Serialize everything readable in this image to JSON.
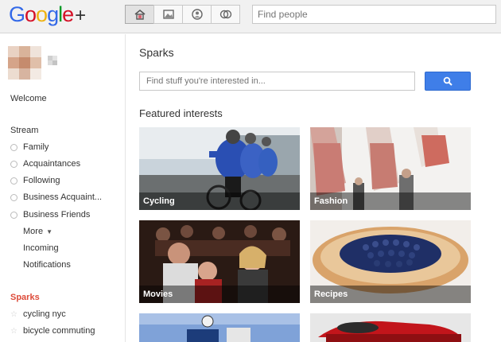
{
  "header": {
    "logo_letters": [
      "G",
      "o",
      "o",
      "g",
      "l",
      "e"
    ],
    "logo_plus": "+",
    "nav": [
      {
        "name": "home-icon",
        "active": true
      },
      {
        "name": "photos-icon",
        "active": false
      },
      {
        "name": "profile-icon",
        "active": false
      },
      {
        "name": "circles-icon",
        "active": false
      }
    ],
    "search_placeholder": "Find people"
  },
  "sidebar": {
    "welcome": "Welcome",
    "stream_label": "Stream",
    "circles": [
      "Family",
      "Acquaintances",
      "Following",
      "Business Acquaint...",
      "Business Friends"
    ],
    "more_label": "More",
    "incoming_label": "Incoming",
    "notifications_label": "Notifications",
    "sparks_label": "Sparks",
    "sparks_items": [
      "cycling nyc",
      "bicycle commuting"
    ]
  },
  "main": {
    "title": "Sparks",
    "search_placeholder": "Find stuff you're interested in...",
    "featured_label": "Featured interests",
    "tiles": [
      {
        "label": "Cycling"
      },
      {
        "label": "Fashion"
      },
      {
        "label": "Movies"
      },
      {
        "label": "Recipes"
      },
      {
        "label": ""
      },
      {
        "label": ""
      }
    ]
  },
  "colors": {
    "accent_blue": "#3f7ee8",
    "sparks_red": "#dd4b39"
  }
}
